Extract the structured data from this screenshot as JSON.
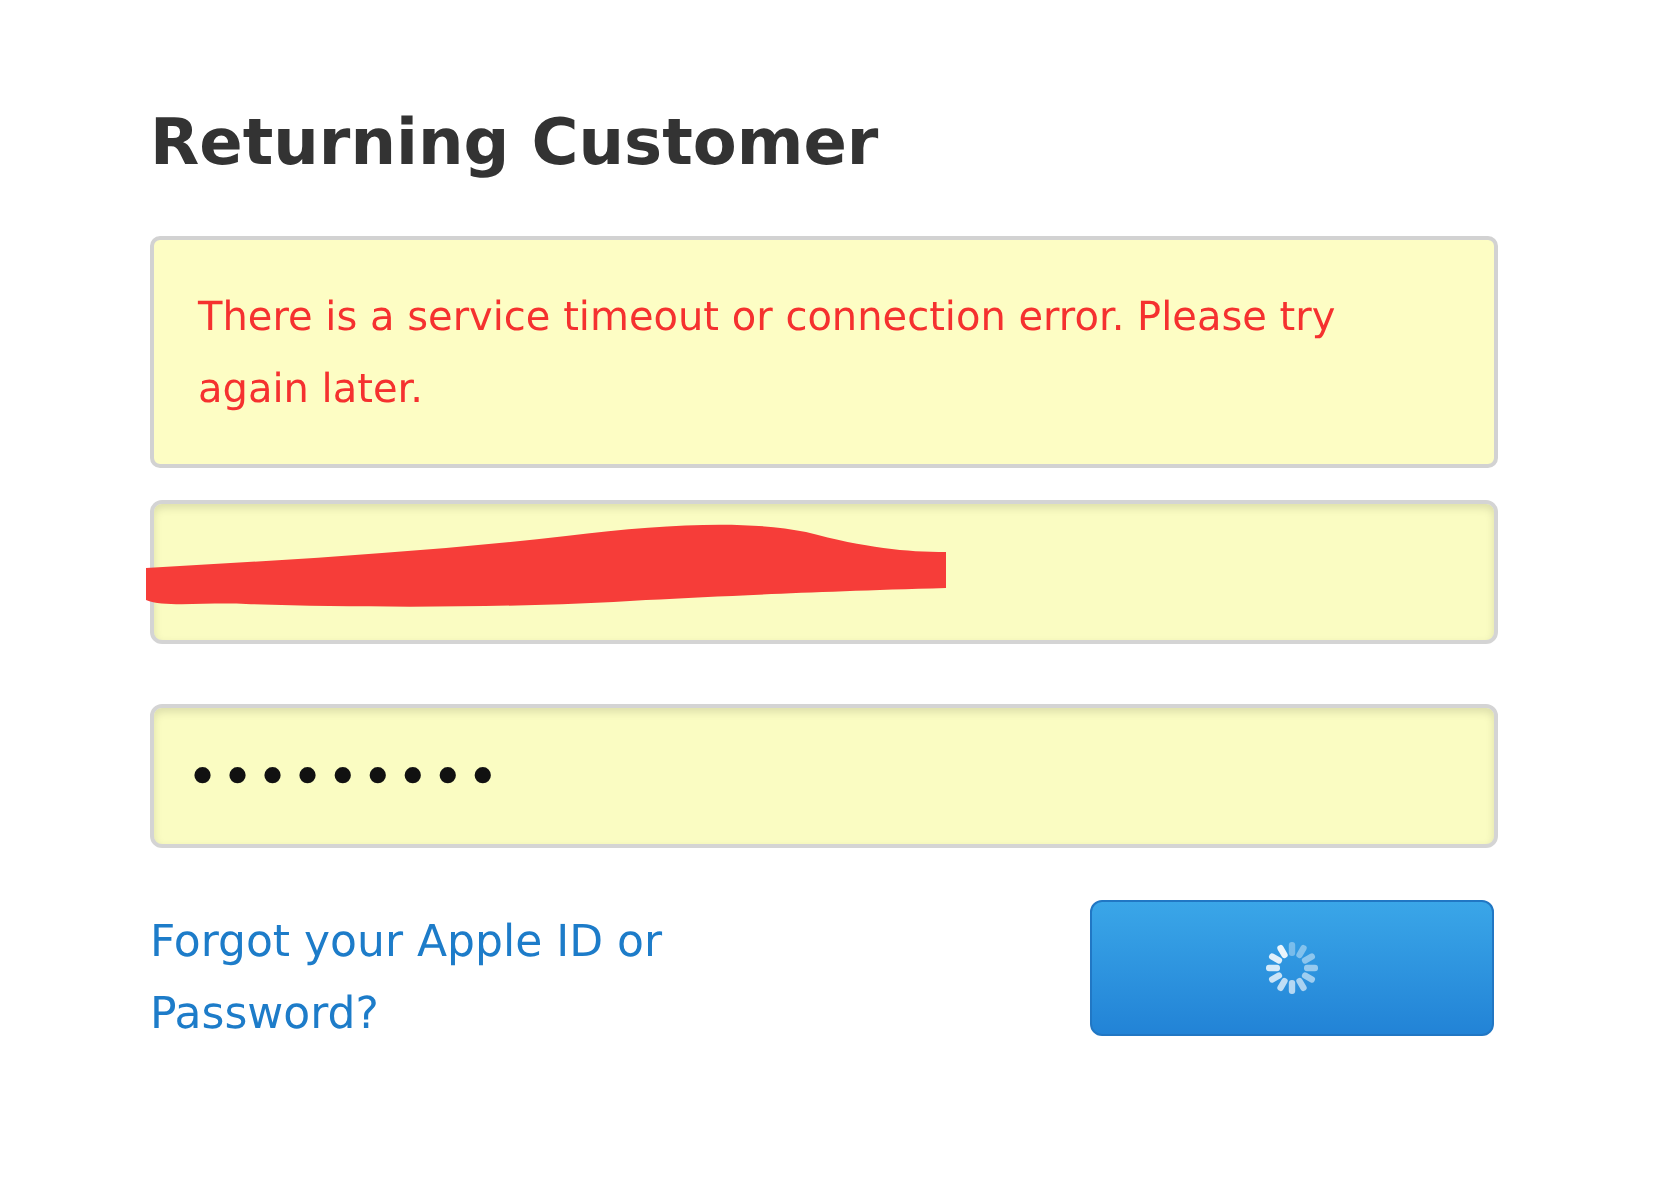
{
  "heading": "Returning Customer",
  "error": {
    "message": "There is a service timeout or connection error. Please try again later."
  },
  "email_field": {
    "redacted": true
  },
  "password_field": {
    "value": "•••••••••"
  },
  "forgot_link": "Forgot your Apple ID or Password?",
  "sign_in_button": {
    "loading": true
  }
}
